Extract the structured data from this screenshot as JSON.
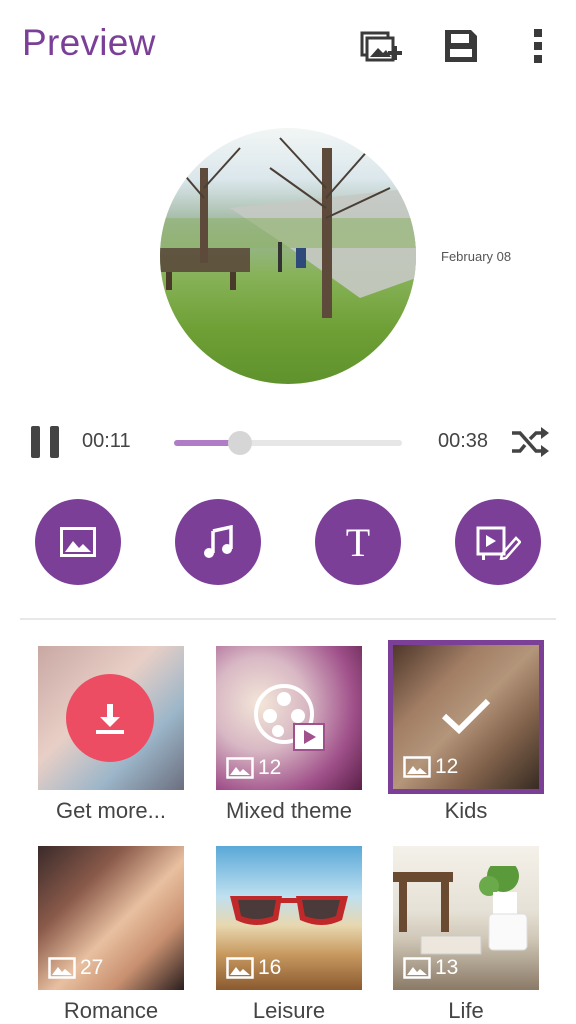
{
  "appbar": {
    "title": "Preview",
    "icons": [
      "add-photo-icon",
      "save-icon",
      "more-vert-icon"
    ]
  },
  "preview": {
    "date": "February 08"
  },
  "player": {
    "elapsed": "00:11",
    "duration": "00:38",
    "progress": 0.29
  },
  "actions": [
    {
      "name": "photos-button",
      "icon": "image-icon"
    },
    {
      "name": "music-button",
      "icon": "music-note-icon"
    },
    {
      "name": "text-button",
      "icon": "text-icon",
      "glyph": "T"
    },
    {
      "name": "edit-video-button",
      "icon": "video-edit-icon"
    }
  ],
  "themes": [
    {
      "label": "Get more...",
      "count": null
    },
    {
      "label": "Mixed theme",
      "count": "12"
    },
    {
      "label": "Kids",
      "count": "12",
      "selected": true
    },
    {
      "label": "Romance",
      "count": "27"
    },
    {
      "label": "Leisure",
      "count": "16"
    },
    {
      "label": "Life",
      "count": "13"
    }
  ],
  "colors": {
    "accent": "#7b3f98",
    "download_badge": "#ec4d63"
  }
}
